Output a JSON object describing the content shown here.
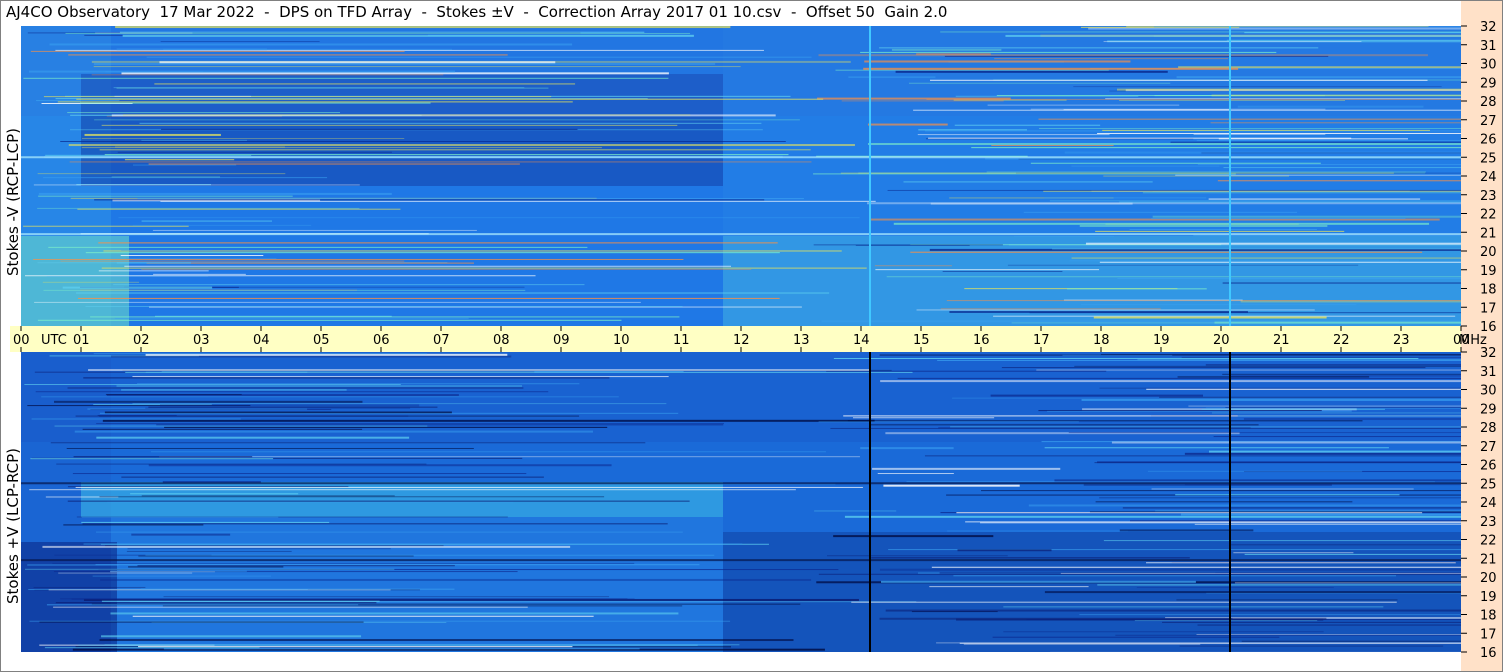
{
  "title": "AJ4CO Observatory  17 Mar 2022  -  DPS on TFD Array  -  Stokes ±V  -  Correction Array 2017 01 10.csv  -  Offset 50  Gain 2.0",
  "chart_data": {
    "type": "heatmap",
    "panels": [
      {
        "ylabel": "Stokes -V (RCP-LCP)",
        "baseColor": "#1f78e6",
        "profile": "negative"
      },
      {
        "ylabel": "Stokes +V (LCP-RCP)",
        "baseColor": "#1a6ad8",
        "profile": "positive"
      }
    ],
    "x_axis": {
      "ticks": [
        "00",
        "01",
        "02",
        "03",
        "04",
        "05",
        "06",
        "07",
        "08",
        "09",
        "10",
        "11",
        "12",
        "13",
        "14",
        "15",
        "16",
        "17",
        "18",
        "19",
        "20",
        "21",
        "22",
        "23",
        "00"
      ],
      "unit": "UTC",
      "range": [
        0,
        24
      ]
    },
    "y_axis": {
      "ticks": [
        "16",
        "17",
        "18",
        "19",
        "20",
        "21",
        "22",
        "23",
        "24",
        "25",
        "26",
        "27",
        "28",
        "29",
        "30",
        "31",
        "32"
      ],
      "unit": "MHz",
      "range": [
        16,
        32
      ]
    },
    "vertical_lines_utc": [
      14.15,
      20.15
    ]
  }
}
